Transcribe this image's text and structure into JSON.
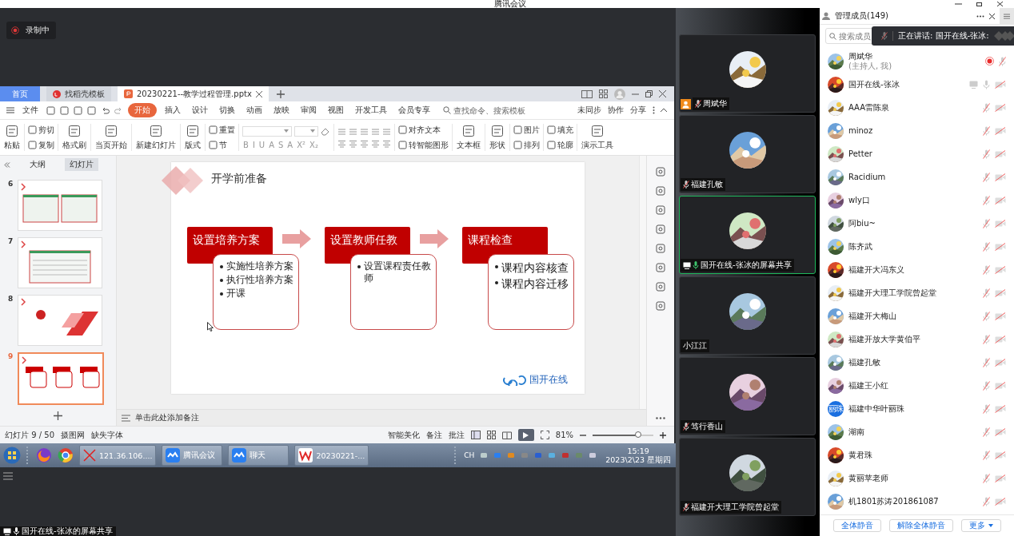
{
  "window": {
    "title": "腾讯会议"
  },
  "recording": {
    "label": "录制中"
  },
  "wps": {
    "tabs": [
      {
        "label": "首页",
        "kind": "home",
        "selected": false
      },
      {
        "label": "找稻壳模板",
        "kind": "docer",
        "selected": false
      },
      {
        "label": "20230221--教学过程管理.pptx",
        "kind": "doc",
        "selected": true
      }
    ],
    "menu": [
      {
        "label": "文件",
        "selected": false
      },
      {
        "label": "开始",
        "selected": true
      },
      {
        "label": "插入",
        "selected": false
      },
      {
        "label": "设计",
        "selected": false
      },
      {
        "label": "切换",
        "selected": false
      },
      {
        "label": "动画",
        "selected": false
      },
      {
        "label": "放映",
        "selected": false
      },
      {
        "label": "审阅",
        "selected": false
      },
      {
        "label": "视图",
        "selected": false
      },
      {
        "label": "开发工具",
        "selected": false
      },
      {
        "label": "会员专享",
        "selected": false
      }
    ],
    "search": {
      "placeholder": "查找命令、搜索模板"
    },
    "menu_right": [
      "未同步",
      "协作",
      "分享"
    ],
    "ribbon": [
      {
        "kind": "large",
        "label": "粘贴"
      },
      {
        "kind": "small",
        "items": [
          "剪切",
          "复制"
        ]
      },
      {
        "kind": "large",
        "label": "格式刷"
      },
      {
        "kind": "large",
        "label": "当页开始"
      },
      {
        "kind": "large",
        "label": "新建幻灯片"
      },
      {
        "kind": "large",
        "label": "版式"
      },
      {
        "kind": "small",
        "items": [
          "重置",
          "节"
        ]
      },
      {
        "kind": "font",
        "glyphs": [
          "B",
          "I",
          "U",
          "A",
          "S",
          "A",
          "X²",
          "X₂"
        ]
      },
      {
        "kind": "paragraph"
      },
      {
        "kind": "small",
        "items": [
          "对齐文本",
          "转智能图形"
        ]
      },
      {
        "kind": "large",
        "label": "文本框"
      },
      {
        "kind": "large",
        "label": "形状"
      },
      {
        "kind": "small",
        "items": [
          "图片",
          "排列"
        ]
      },
      {
        "kind": "small",
        "items": [
          "填充",
          "轮廓"
        ]
      },
      {
        "kind": "large",
        "label": "演示工具"
      }
    ],
    "panel_tabs": [
      {
        "label": "大纲",
        "selected": false
      },
      {
        "label": "幻灯片",
        "selected": true
      }
    ],
    "thumbnails": [
      {
        "number": "6",
        "kind": "screens",
        "selected": false
      },
      {
        "number": "7",
        "kind": "table",
        "selected": false
      },
      {
        "number": "8",
        "kind": "section",
        "selected": false
      },
      {
        "number": "9",
        "kind": "flow",
        "selected": true
      }
    ],
    "slide": {
      "title": "开学前准备",
      "steps": [
        {
          "heading": "设置培养方案",
          "bullets": [
            "实施性培养方案",
            "执行性培养方案",
            "开课"
          ]
        },
        {
          "heading": "设置教师任教",
          "bullets": [
            "设置课程责任教师"
          ]
        },
        {
          "heading": "课程检查",
          "bullets": [
            "课程内容核查",
            "课程内容迁移"
          ]
        }
      ],
      "logo": "国开在线"
    },
    "notes_placeholder": "单击此处添加备注",
    "status": {
      "slide": "幻灯片 9 / 50",
      "left": [
        "摄图网",
        "缺失字体"
      ],
      "right": [
        "智能美化",
        "备注",
        "批注"
      ],
      "zoom": "81%",
      "level": 0.75
    }
  },
  "taskbar": {
    "apps": [
      {
        "label": "121.36.106....",
        "kind": "remote"
      },
      {
        "label": "腾讯会议",
        "kind": "meeting"
      },
      {
        "label": "聊天",
        "kind": "meeting"
      },
      {
        "label": "20230221-...",
        "kind": "wps"
      }
    ],
    "lang": "CH",
    "time": "15:19",
    "date": "2023\\2\\23 星期四"
  },
  "share_label": "国开在线-张冰的屏幕共享",
  "videos": [
    {
      "name": "周斌华",
      "mic_icon": true,
      "muted": true,
      "host": true,
      "sharing": false,
      "active": false
    },
    {
      "name": "福建孔敏",
      "mic_icon": true,
      "muted": true,
      "host": false,
      "sharing": false,
      "active": false
    },
    {
      "name": "国开在线-张冰的屏幕共享",
      "mic_icon": true,
      "muted": false,
      "host": false,
      "sharing": true,
      "active": true
    },
    {
      "name": "小江江",
      "mic_icon": false,
      "host": false,
      "sharing": false,
      "active": false
    },
    {
      "name": "笃行香山",
      "mic_icon": true,
      "muted": true,
      "host": false,
      "sharing": false,
      "active": false
    },
    {
      "name": "福建开大理工学院曾起堂",
      "mic_icon": true,
      "muted": true,
      "host": false,
      "sharing": false,
      "active": false
    }
  ],
  "members": {
    "title": "管理成员(149)",
    "search": {
      "placeholder": "搜索成员"
    },
    "speaking": "正在讲话: 国开在线-张冰:",
    "list": [
      {
        "name": "周斌华",
        "note": "(主持人, 我)",
        "recording": true,
        "sharing": false,
        "muted": true,
        "camera_icon": false
      },
      {
        "name": "国开在线-张冰",
        "recording": false,
        "sharing": true,
        "muted": false,
        "camera_icon": true
      },
      {
        "name": "AAA雷陈泉",
        "recording": false,
        "sharing": false,
        "muted": true,
        "camera_icon": true
      },
      {
        "name": "minoz",
        "recording": false,
        "sharing": false,
        "muted": true,
        "camera_icon": true
      },
      {
        "name": "Petter",
        "recording": false,
        "sharing": false,
        "muted": true,
        "camera_icon": true
      },
      {
        "name": "Racidium",
        "recording": false,
        "sharing": false,
        "muted": true,
        "camera_icon": true
      },
      {
        "name": "wly口",
        "recording": false,
        "sharing": false,
        "muted": true,
        "camera_icon": true
      },
      {
        "name": "阿biu~",
        "recording": false,
        "sharing": false,
        "muted": true,
        "camera_icon": true
      },
      {
        "name": "陈齐武",
        "recording": false,
        "sharing": false,
        "muted": true,
        "camera_icon": true
      },
      {
        "name": "福建开大冯东义",
        "recording": false,
        "sharing": false,
        "muted": true,
        "camera_icon": true
      },
      {
        "name": "福建开大理工学院曾起堂",
        "recording": false,
        "sharing": false,
        "muted": true,
        "camera_icon": true
      },
      {
        "name": "福建开大梅山",
        "recording": false,
        "sharing": false,
        "muted": true,
        "camera_icon": true
      },
      {
        "name": "福建开放大学黄伯平",
        "recording": false,
        "sharing": false,
        "muted": true,
        "camera_icon": true
      },
      {
        "name": "福建孔敏",
        "recording": false,
        "sharing": false,
        "muted": true,
        "camera_icon": true
      },
      {
        "name": "福建王小红",
        "recording": false,
        "sharing": false,
        "muted": true,
        "camera_icon": true
      },
      {
        "name": "福建中华叶丽珠",
        "avatar_text": "丽珠",
        "recording": false,
        "sharing": false,
        "muted": true,
        "camera_icon": true
      },
      {
        "name": "湖南",
        "recording": false,
        "sharing": false,
        "muted": true,
        "camera_icon": true
      },
      {
        "name": "黄君珠",
        "recording": false,
        "sharing": false,
        "muted": true,
        "camera_icon": true
      },
      {
        "name": "黄丽苹老师",
        "recording": false,
        "sharing": false,
        "muted": true,
        "camera_icon": true
      },
      {
        "name": "机1801苏涛201861087",
        "recording": false,
        "sharing": false,
        "muted": true,
        "camera_icon": true
      }
    ],
    "buttons": [
      {
        "label": "全体静音",
        "kind": "plain"
      },
      {
        "label": "解除全体静音",
        "kind": "plain"
      },
      {
        "label": "更多",
        "kind": "dropdown"
      }
    ]
  }
}
